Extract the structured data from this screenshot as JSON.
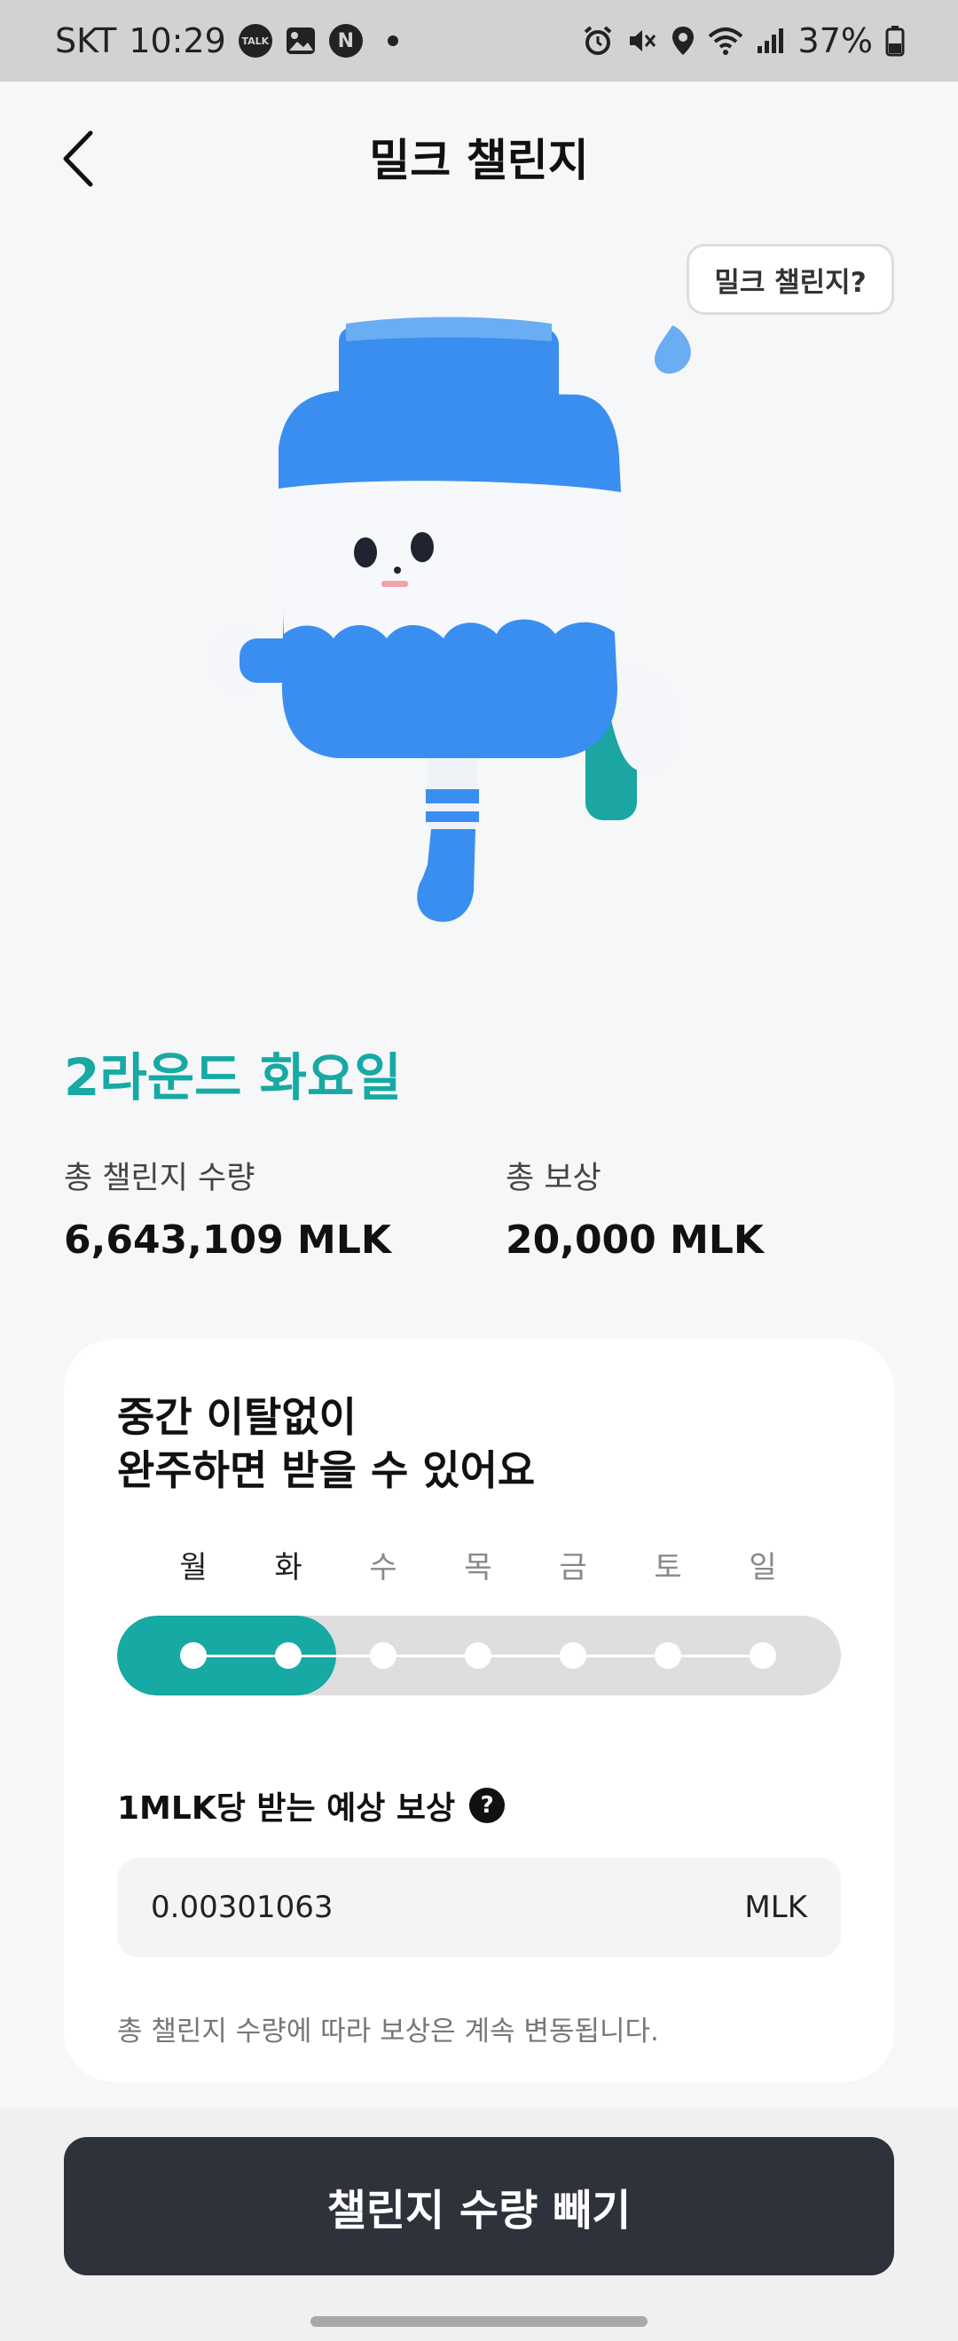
{
  "status_bar": {
    "carrier": "SKT",
    "time": "10:29",
    "battery": "37%",
    "notification_icons": [
      "talk-icon",
      "gallery-icon",
      "naver-icon"
    ],
    "system_icons": [
      "alarm-icon",
      "mute-icon",
      "location-icon",
      "wifi-icon",
      "signal-icon",
      "battery-icon"
    ],
    "talk_badge": "TALK",
    "naver_badge": "N"
  },
  "header": {
    "title": "밀크 챌린지"
  },
  "help_chip": "밀크 챌린지?",
  "round_title": "2라운드 화요일",
  "stats": {
    "total_label": "총 챌린지 수량",
    "total_value": "6,643,109 MLK",
    "reward_label": "총 보상",
    "reward_value": "20,000 MLK"
  },
  "card": {
    "heading_line1": "중간 이탈없이",
    "heading_line2": "완주하면 받을 수 있어요",
    "days": [
      "월",
      "화",
      "수",
      "목",
      "금",
      "토",
      "일"
    ],
    "completed_days": 2,
    "reward_label": "1MLK당 받는 예상 보상",
    "help_icon_glyph": "?",
    "reward_value": "0.00301063",
    "reward_unit": "MLK",
    "note": "총 챌린지 수량에 따라 보상은 계속 변동됩니다."
  },
  "cta_label": "챌린지 수량 빼기",
  "colors": {
    "accent": "#17a9a3",
    "button": "#2e323a",
    "mascot_blue": "#3a8ef0"
  }
}
